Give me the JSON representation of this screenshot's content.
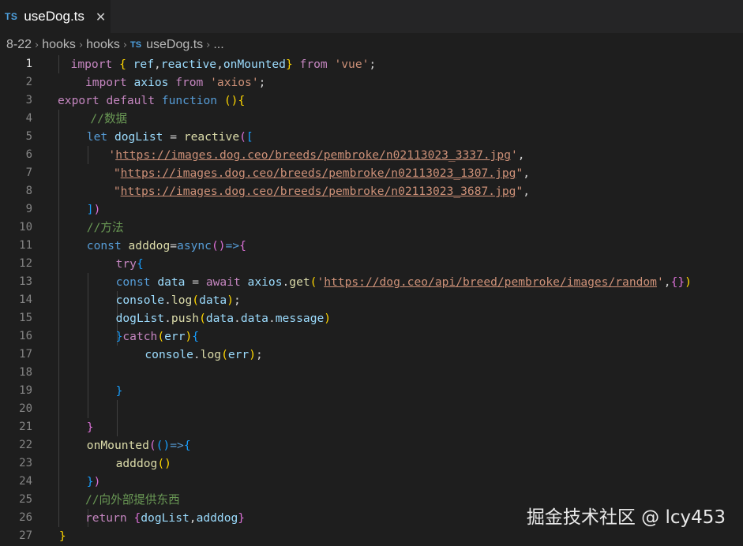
{
  "tab": {
    "lang": "TS",
    "filename": "useDog.ts",
    "close": "✕"
  },
  "breadcrumb": [
    "8-22",
    "hooks",
    "hooks",
    "useDog.ts",
    "..."
  ],
  "breadcrumb_lang": "TS",
  "watermark": "掘金技术社区 @ lcy453",
  "active_line": 1,
  "lines": [
    {
      "n": "1",
      "t": [
        [
          "k",
          "import "
        ],
        [
          "y",
          "{ "
        ],
        [
          "v",
          "ref"
        ],
        [
          "w",
          ","
        ],
        [
          "v",
          "reactive"
        ],
        [
          "w",
          ","
        ],
        [
          "v",
          "onMounted"
        ],
        [
          "y",
          "}"
        ],
        [
          "k",
          " from "
        ],
        [
          "s",
          "'vue'"
        ],
        [
          "w",
          ";"
        ]
      ]
    },
    {
      "n": "2",
      "t": [
        [
          "k",
          "import "
        ],
        [
          "v",
          "axios"
        ],
        [
          "k",
          " from "
        ],
        [
          "s",
          "'axios'"
        ],
        [
          "w",
          ";"
        ]
      ]
    },
    {
      "n": "3",
      "t": [
        [
          "k",
          "export default "
        ],
        [
          "b",
          "function "
        ],
        [
          "y",
          "()"
        ],
        [
          "y",
          "{"
        ]
      ]
    },
    {
      "n": "4",
      "t": [
        [
          "c",
          "//数据"
        ]
      ]
    },
    {
      "n": "5",
      "t": [
        [
          "b",
          "let "
        ],
        [
          "v",
          "dogList"
        ],
        [
          "w",
          " = "
        ],
        [
          "f",
          "reactive"
        ],
        [
          "p",
          "("
        ],
        [
          "q",
          "["
        ]
      ]
    },
    {
      "n": "6",
      "t": [
        [
          "s",
          "'"
        ],
        [
          "u",
          "https://images.dog.ceo/breeds/pembroke/n02113023_3337.jpg"
        ],
        [
          "s",
          "'"
        ],
        [
          "w",
          ","
        ]
      ]
    },
    {
      "n": "7",
      "t": [
        [
          "s",
          "\""
        ],
        [
          "u",
          "https://images.dog.ceo/breeds/pembroke/n02113023_1307.jpg"
        ],
        [
          "s",
          "\""
        ],
        [
          "w",
          ","
        ]
      ]
    },
    {
      "n": "8",
      "t": [
        [
          "s",
          "\""
        ],
        [
          "u",
          "https://images.dog.ceo/breeds/pembroke/n02113023_3687.jpg"
        ],
        [
          "s",
          "\""
        ],
        [
          "w",
          ","
        ]
      ]
    },
    {
      "n": "9",
      "t": [
        [
          "q",
          "]"
        ],
        [
          "p",
          ")"
        ]
      ]
    },
    {
      "n": "10",
      "t": [
        [
          "c",
          "//方法"
        ]
      ]
    },
    {
      "n": "11",
      "t": [
        [
          "b",
          "const "
        ],
        [
          "f",
          "adddog"
        ],
        [
          "w",
          "="
        ],
        [
          "b",
          "async"
        ],
        [
          "p",
          "()"
        ],
        [
          "b",
          "=>"
        ],
        [
          "p",
          "{"
        ]
      ]
    },
    {
      "n": "12",
      "t": [
        [
          "k",
          "try"
        ],
        [
          "q",
          "{"
        ]
      ]
    },
    {
      "n": "13",
      "t": [
        [
          "b",
          "const "
        ],
        [
          "v",
          "data"
        ],
        [
          "w",
          " = "
        ],
        [
          "k",
          "await "
        ],
        [
          "v",
          "axios"
        ],
        [
          "w",
          "."
        ],
        [
          "f",
          "get"
        ],
        [
          "y",
          "("
        ],
        [
          "s",
          "'"
        ],
        [
          "u",
          "https://dog.ceo/api/breed/pembroke/images/random"
        ],
        [
          "s",
          "'"
        ],
        [
          "w",
          ","
        ],
        [
          "p",
          "{}"
        ],
        [
          "y",
          ")"
        ]
      ]
    },
    {
      "n": "14",
      "t": [
        [
          "v",
          "console"
        ],
        [
          "w",
          "."
        ],
        [
          "f",
          "log"
        ],
        [
          "y",
          "("
        ],
        [
          "v",
          "data"
        ],
        [
          "y",
          ")"
        ],
        [
          "w",
          ";"
        ]
      ]
    },
    {
      "n": "15",
      "t": [
        [
          "v",
          "dogList"
        ],
        [
          "w",
          "."
        ],
        [
          "f",
          "push"
        ],
        [
          "y",
          "("
        ],
        [
          "v",
          "data"
        ],
        [
          "w",
          "."
        ],
        [
          "v",
          "data"
        ],
        [
          "w",
          "."
        ],
        [
          "v",
          "message"
        ],
        [
          "y",
          ")"
        ]
      ]
    },
    {
      "n": "16",
      "t": [
        [
          "q",
          "}"
        ],
        [
          "k",
          "catch"
        ],
        [
          "y",
          "("
        ],
        [
          "v",
          "err"
        ],
        [
          "y",
          ")"
        ],
        [
          "q",
          "{"
        ]
      ]
    },
    {
      "n": "17",
      "t": [
        [
          "v",
          "console"
        ],
        [
          "w",
          "."
        ],
        [
          "f",
          "log"
        ],
        [
          "y",
          "("
        ],
        [
          "v",
          "err"
        ],
        [
          "y",
          ")"
        ],
        [
          "w",
          ";"
        ]
      ]
    },
    {
      "n": "18",
      "t": []
    },
    {
      "n": "19",
      "t": [
        [
          "q",
          "}"
        ]
      ]
    },
    {
      "n": "20",
      "t": []
    },
    {
      "n": "21",
      "t": [
        [
          "p",
          "}"
        ]
      ]
    },
    {
      "n": "22",
      "t": [
        [
          "f",
          "onMounted"
        ],
        [
          "p",
          "("
        ],
        [
          "q",
          "()"
        ],
        [
          "b",
          "=>"
        ],
        [
          "q",
          "{"
        ]
      ]
    },
    {
      "n": "23",
      "t": [
        [
          "f",
          "adddog"
        ],
        [
          "y",
          "()"
        ]
      ]
    },
    {
      "n": "24",
      "t": [
        [
          "q",
          "}"
        ],
        [
          "p",
          ")"
        ]
      ]
    },
    {
      "n": "25",
      "t": [
        [
          "c",
          "//向外部提供东西"
        ]
      ]
    },
    {
      "n": "26",
      "t": [
        [
          "k",
          "return "
        ],
        [
          "p",
          "{"
        ],
        [
          "v",
          "dogList"
        ],
        [
          "w",
          ","
        ],
        [
          "v",
          "adddog"
        ],
        [
          "p",
          "}"
        ]
      ]
    },
    {
      "n": "27",
      "t": [
        [
          "y",
          "}"
        ]
      ]
    }
  ]
}
